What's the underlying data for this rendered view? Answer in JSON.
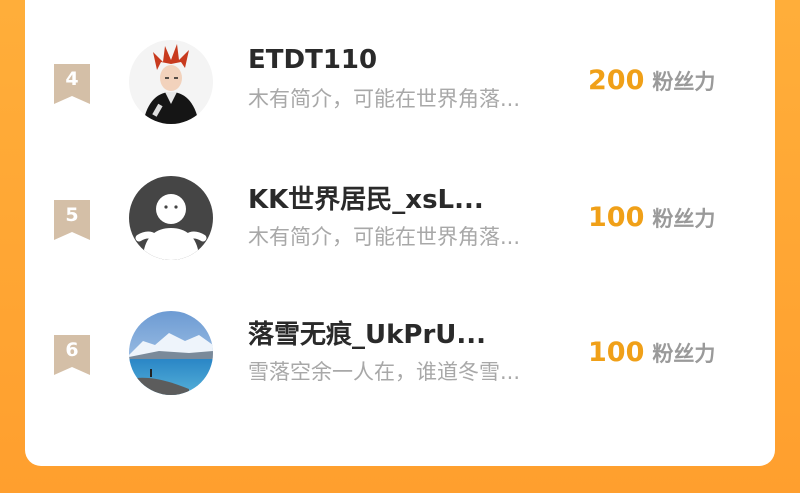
{
  "colors": {
    "page_background": "#ffa534",
    "card_background": "#ffffff",
    "rank_badge": "#d4bfa7",
    "fans_number": "#f0a018",
    "fans_label": "#9a9a9a",
    "name_text": "#2a2a2a",
    "desc_text": "#a8a8a8"
  },
  "ranking": [
    {
      "rank": "4",
      "avatar": "anime-red-hair-avatar",
      "name": "ETDT110",
      "description": "木有简介，可能在世界角落...",
      "fans_count": "200",
      "fans_label": "粉丝力"
    },
    {
      "rank": "5",
      "avatar": "default-user-avatar",
      "name": "KK世界居民_xsL...",
      "description": "木有简介，可能在世界角落...",
      "fans_count": "100",
      "fans_label": "粉丝力"
    },
    {
      "rank": "6",
      "avatar": "lake-mountain-avatar",
      "name": "落雪无痕_UkPrU...",
      "description": "雪落空余一人在，谁道冬雪...",
      "fans_count": "100",
      "fans_label": "粉丝力"
    }
  ]
}
